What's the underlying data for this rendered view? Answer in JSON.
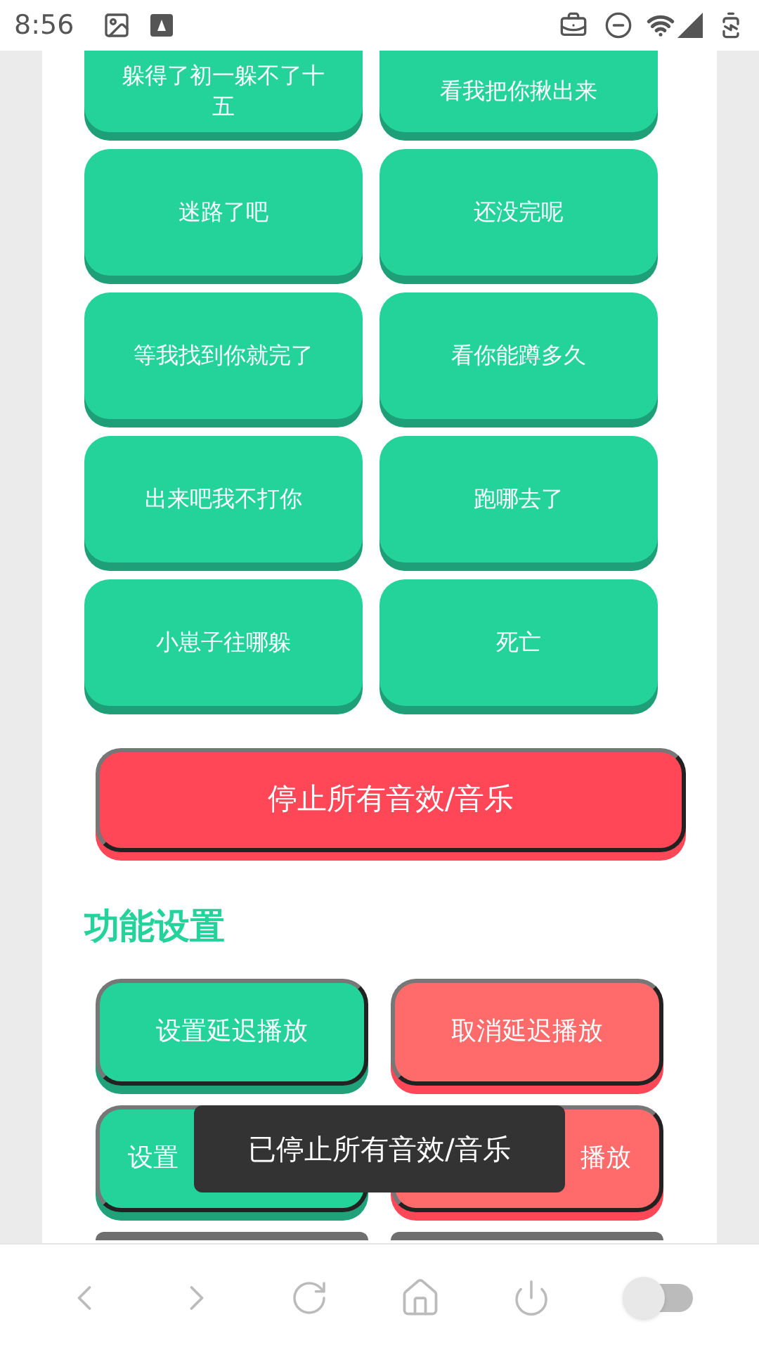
{
  "status_bar": {
    "time": "8:56"
  },
  "sound_buttons": [
    {
      "label": "躲得了初一躲不了十五"
    },
    {
      "label": "看我把你揪出来"
    },
    {
      "label": "迷路了吧"
    },
    {
      "label": "还没完呢"
    },
    {
      "label": "等我找到你就完了"
    },
    {
      "label": "看你能蹲多久"
    },
    {
      "label": "出来吧我不打你"
    },
    {
      "label": "跑哪去了"
    },
    {
      "label": "小崽子往哪躲"
    },
    {
      "label": "死亡"
    }
  ],
  "stop_button": {
    "label": "停止所有音效/音乐"
  },
  "section_title": "功能设置",
  "settings_buttons": [
    {
      "kind": "set",
      "label": "设置延迟播放"
    },
    {
      "kind": "cancel",
      "label": "取消延迟播放"
    },
    {
      "kind": "set",
      "label": "设置"
    },
    {
      "kind": "cancel",
      "label": "播放"
    },
    {
      "kind": "partial"
    },
    {
      "kind": "partial"
    }
  ],
  "toast": {
    "text": "已停止所有音效/音乐"
  },
  "nav_bar": {
    "toggle": {
      "on": false
    }
  }
}
